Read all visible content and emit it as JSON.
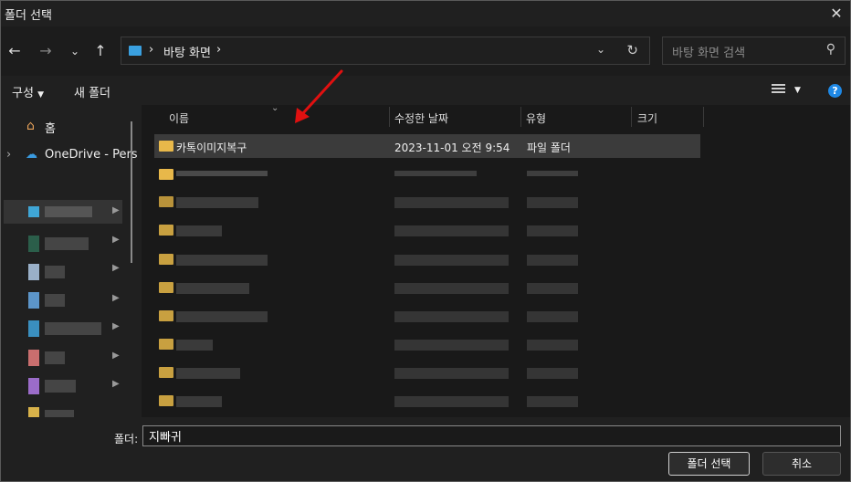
{
  "window": {
    "title": "폴더 선택"
  },
  "address": {
    "crumbs": [
      "바탕 화면"
    ]
  },
  "search": {
    "placeholder": "바탕 화면 검색"
  },
  "toolbar": {
    "organize": "구성",
    "new_folder": "새 폴더"
  },
  "nav": {
    "home": "홈",
    "onedrive": "OneDrive - Pers"
  },
  "list": {
    "headers": {
      "name": "이름",
      "date": "수정한 날짜",
      "type": "유형",
      "size": "크기"
    },
    "rows": [
      {
        "name": "카톡이미지복구",
        "date": "2023-11-01 오전 9:54",
        "type": "파일 폴더"
      }
    ]
  },
  "footer": {
    "folder_label": "폴더:",
    "folder_value": "지빠귀",
    "select": "폴더 선택",
    "cancel": "취소"
  },
  "colors": {
    "accent": "#1e88e5",
    "folder": "#e8b84a",
    "annotation": "#e01010"
  }
}
